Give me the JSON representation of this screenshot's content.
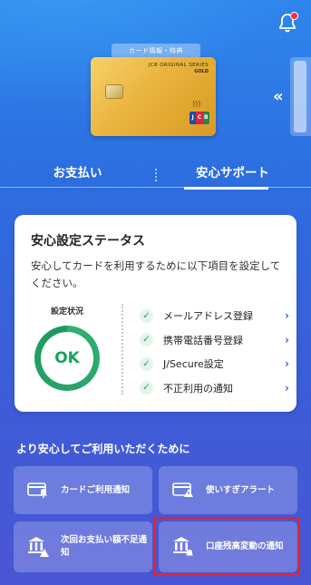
{
  "card": {
    "tag": "カード情報・特典",
    "series": "JCB ORIGINAL SERIES",
    "grade": "GOLD",
    "brand": [
      "J",
      "C",
      "B"
    ],
    "colors": [
      "#1a4fa8",
      "#d7263d",
      "#1f8a4c"
    ]
  },
  "tabs": [
    {
      "label": "お支払い",
      "active": false
    },
    {
      "label": "安心サポート",
      "active": true
    }
  ],
  "status": {
    "title": "安心設定ステータス",
    "description": "安心してカードを利用するために以下項目を設定してください。",
    "state_label": "設定状況",
    "state_value": "OK",
    "items": [
      {
        "label": "メールアドレス登録"
      },
      {
        "label": "携帯電話番号登録"
      },
      {
        "label": "J/Secure設定"
      },
      {
        "label": "不正利用の通知"
      }
    ]
  },
  "more": {
    "heading": "より安心してご利用いただくために",
    "tiles": [
      {
        "label": "カードご利用通知",
        "icon": "card-notification-icon"
      },
      {
        "label": "使いすぎアラート",
        "icon": "card-alert-icon"
      },
      {
        "label": "次回お支払い額不足通知",
        "icon": "bank-alert-icon"
      },
      {
        "label": "口座残高変動の通知",
        "icon": "bank-bell-icon"
      }
    ]
  },
  "accent": "#2b63e0",
  "ok_color": "#18a35a",
  "highlight_color": "#e3242b"
}
